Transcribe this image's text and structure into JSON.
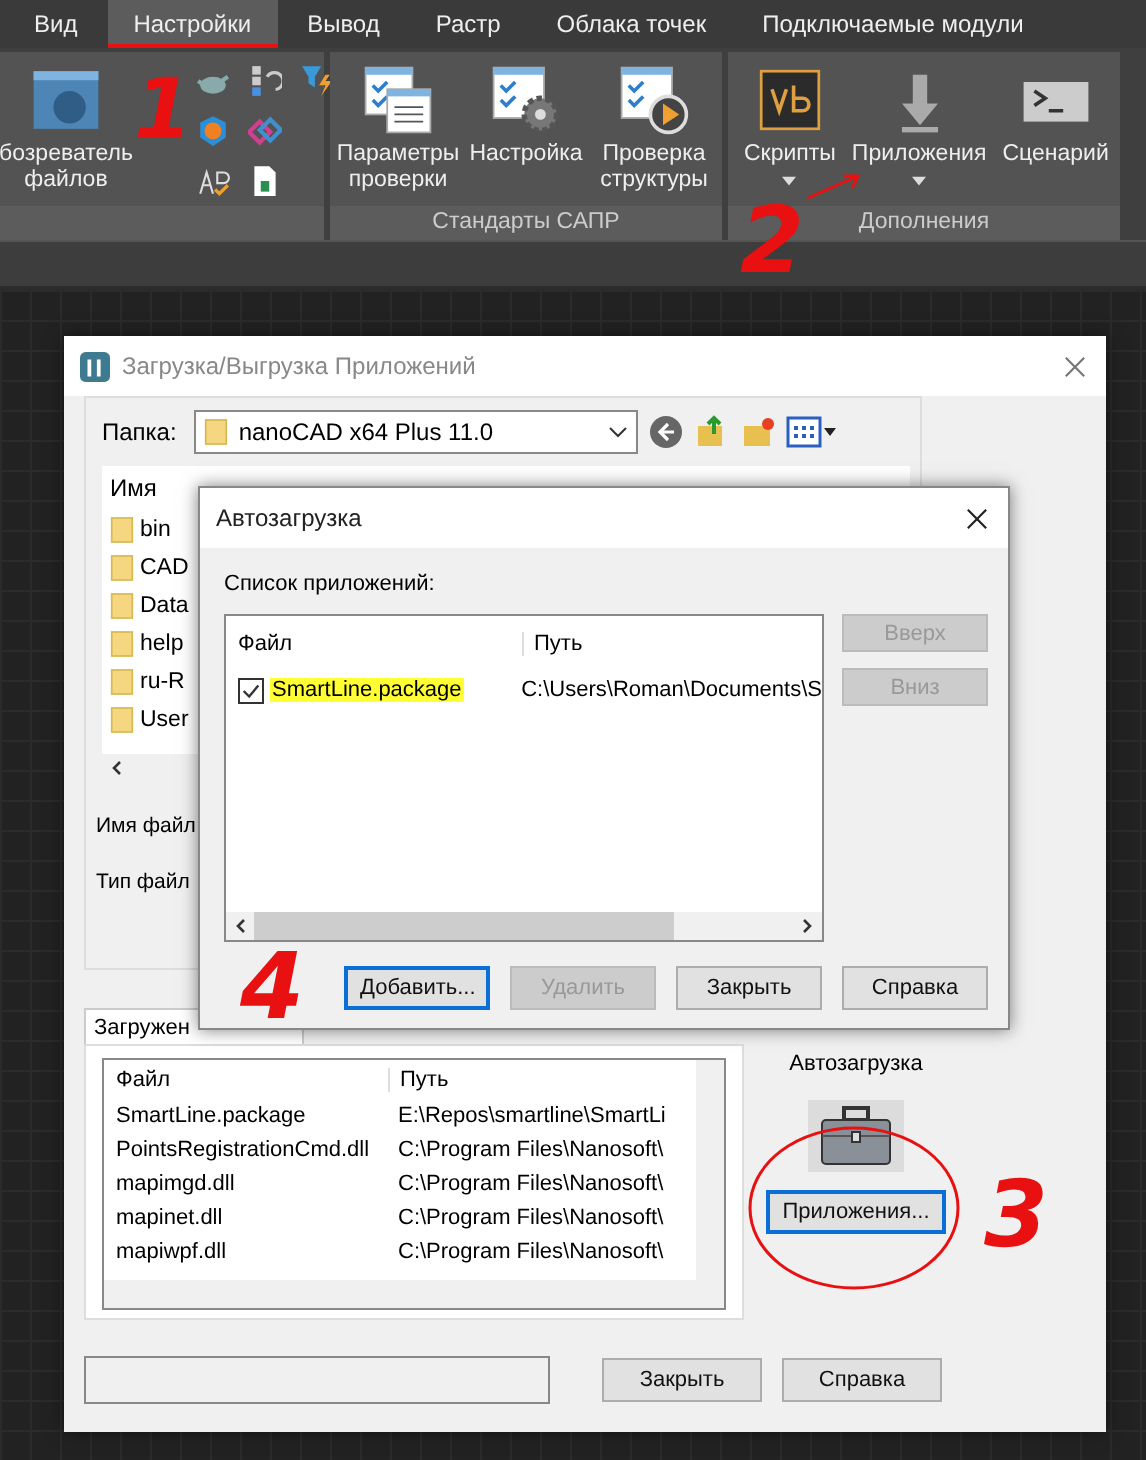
{
  "ribbon": {
    "tabs": [
      {
        "label": "Вид",
        "selected": false
      },
      {
        "label": "Настройки",
        "selected": true
      },
      {
        "label": "Вывод",
        "selected": false
      },
      {
        "label": "Растр",
        "selected": false
      },
      {
        "label": "Облака точек",
        "selected": false
      },
      {
        "label": "Подключаемые модули",
        "selected": false
      }
    ],
    "panels": [
      {
        "buttons": [
          {
            "kind": "browser",
            "label": "бозреватель файлов",
            "dropdown": false
          }
        ]
      },
      {
        "title": "Стандарты САПР",
        "buttons": [
          {
            "kind": "params",
            "label": "Параметры проверки",
            "dropdown": false
          },
          {
            "kind": "setup",
            "label": "Настройка",
            "dropdown": false
          },
          {
            "kind": "check",
            "label": "Проверка структуры",
            "dropdown": false
          }
        ]
      },
      {
        "title": "Дополнения",
        "buttons": [
          {
            "kind": "vb",
            "label": "Скрипты",
            "dropdown": true
          },
          {
            "kind": "download",
            "label": "Приложения",
            "dropdown": true
          },
          {
            "kind": "console",
            "label": "Сценарий",
            "dropdown": false
          }
        ]
      }
    ]
  },
  "app_dialog": {
    "title": "Загрузка/Выгрузка Приложений",
    "folder_label": "Папка:",
    "folder_value": "nanoCAD x64 Plus 11.0",
    "browser_column": "Имя",
    "folders": [
      "bin",
      "CAD",
      "Data",
      "help",
      "ru-R",
      "User"
    ],
    "file_name_label": "Имя файл",
    "file_type_label": "Тип файл",
    "tabs": [
      {
        "label": "Загружен",
        "selected": true
      }
    ],
    "loaded_columns": [
      "Файл",
      "Путь"
    ],
    "loaded_rows": [
      {
        "file": "SmartLine.package",
        "path": "E:\\Repos\\smartline\\SmartLi"
      },
      {
        "file": "PointsRegistrationCmd.dll",
        "path": "C:\\Program Files\\Nanosoft\\"
      },
      {
        "file": "mapimgd.dll",
        "path": "C:\\Program Files\\Nanosoft\\"
      },
      {
        "file": "mapinet.dll",
        "path": "C:\\Program Files\\Nanosoft\\"
      },
      {
        "file": "mapiwpf.dll",
        "path": "C:\\Program Files\\Nanosoft\\"
      }
    ],
    "autoload_label": "Автозагрузка",
    "autoload_button": "Приложения...",
    "buttons": [
      "Закрыть",
      "Справка"
    ]
  },
  "autoload_dialog": {
    "title": "Автозагрузка",
    "list_label": "Список приложений:",
    "columns": [
      "Файл",
      "Путь"
    ],
    "rows": [
      {
        "file": "SmartLine.package",
        "path": "C:\\Users\\Roman\\Documents\\S",
        "checked": true,
        "highlighted": true
      }
    ],
    "side_buttons": [
      {
        "label": "Вверх",
        "disabled": true
      },
      {
        "label": "Вниз",
        "disabled": true
      }
    ],
    "buttons": [
      {
        "label": "Добавить...",
        "disabled": false,
        "focused": true
      },
      {
        "label": "Удалить",
        "disabled": true,
        "focused": false
      },
      {
        "label": "Закрыть",
        "disabled": false,
        "focused": false
      },
      {
        "label": "Справка",
        "disabled": false,
        "focused": false
      }
    ]
  },
  "annotations": [
    "1",
    "2",
    "3",
    "4"
  ]
}
